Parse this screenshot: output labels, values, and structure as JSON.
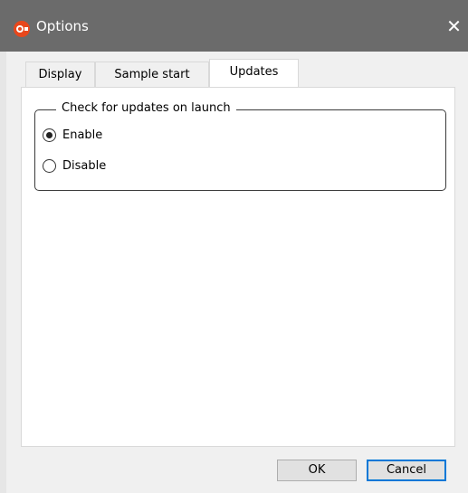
{
  "window": {
    "title": "Options",
    "close_symbol": "✕",
    "app_icon": "app-logo-icon",
    "icon_color": "#e8471c"
  },
  "tabs": [
    {
      "label": "Display",
      "active": false
    },
    {
      "label": "Sample start",
      "active": false
    },
    {
      "label": "Updates",
      "active": true
    }
  ],
  "updates": {
    "group_title": "Check for updates on launch",
    "options": [
      {
        "label": "Enable",
        "checked": true
      },
      {
        "label": "Disable",
        "checked": false
      }
    ]
  },
  "buttons": {
    "ok": "OK",
    "cancel": "Cancel"
  }
}
